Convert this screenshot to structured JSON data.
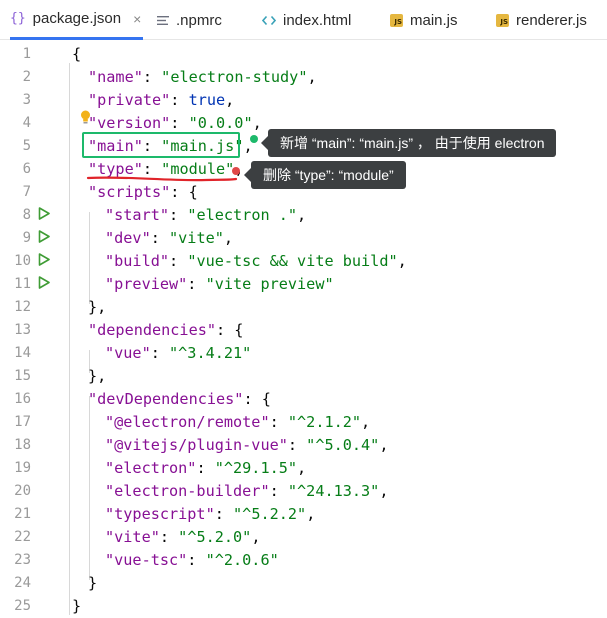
{
  "tabs": [
    {
      "label": "package.json",
      "icon": "braces-icon",
      "active": true,
      "close": "×"
    },
    {
      "label": ".npmrc",
      "icon": "text-file-icon",
      "active": false
    },
    {
      "label": "index.html",
      "icon": "html-icon",
      "active": false
    },
    {
      "label": "main.js",
      "icon": "js-file-icon",
      "active": false
    },
    {
      "label": "renderer.js",
      "icon": "js-file-icon",
      "active": false
    }
  ],
  "js_badge": "JS",
  "gutter": [
    "1",
    "2",
    "3",
    "4",
    "5",
    "6",
    "7",
    "8",
    "9",
    "10",
    "11",
    "12",
    "13",
    "14",
    "15",
    "16",
    "17",
    "18",
    "19",
    "20",
    "21",
    "22",
    "23",
    "24",
    "25"
  ],
  "code": {
    "l1": "{",
    "name_key": "\"name\"",
    "name_val": "\"electron-study\"",
    "private_key": "\"private\"",
    "private_val": "true",
    "version_key": "\"version\"",
    "version_val": "\"0.0.0\"",
    "main_key": "\"main\"",
    "main_val": "\"main.js\"",
    "type_key": "\"type\"",
    "type_val": "\"module\"",
    "scripts_key": "\"scripts\"",
    "start_key": "\"start\"",
    "start_val": "\"electron .\"",
    "dev_key": "\"dev\"",
    "dev_val": "\"vite\"",
    "build_key": "\"build\"",
    "build_val": "\"vue-tsc && vite build\"",
    "preview_key": "\"preview\"",
    "preview_val": "\"vite preview\"",
    "close_obj_comma": "},",
    "deps_key": "\"dependencies\"",
    "vue_key": "\"vue\"",
    "vue_val": "\"^3.4.21\"",
    "devdeps_key": "\"devDependencies\"",
    "remote_key": "\"@electron/remote\"",
    "remote_val": "\"^2.1.2\"",
    "pluginvue_key": "\"@vitejs/plugin-vue\"",
    "pluginvue_val": "\"^5.0.4\"",
    "electron_key": "\"electron\"",
    "electron_val": "\"^29.1.5\"",
    "builder_key": "\"electron-builder\"",
    "builder_val": "\"^24.13.3\"",
    "ts_key": "\"typescript\"",
    "ts_val": "\"^5.2.2\"",
    "vite_key": "\"vite\"",
    "vite_val": "\"^5.2.0\"",
    "vuetsc_key": "\"vue-tsc\"",
    "vuetsc_val": "\"^2.0.6\"",
    "close_inner": "}",
    "close_outer": "}"
  },
  "annotations": {
    "add_main": "新增 “main”: “main.js”  ， 由于使用 electron",
    "remove_type": "删除 “type”: “module”"
  },
  "colors": {
    "key": "#871094",
    "string": "#067d17",
    "keyword": "#0033b3",
    "highlight_box": "#1db96b",
    "underline": "#e0242a",
    "green_dot": "#1db96b",
    "red_dot": "#e04848",
    "run_icon": "#3f9c35",
    "active_tab": "#3574f0"
  }
}
